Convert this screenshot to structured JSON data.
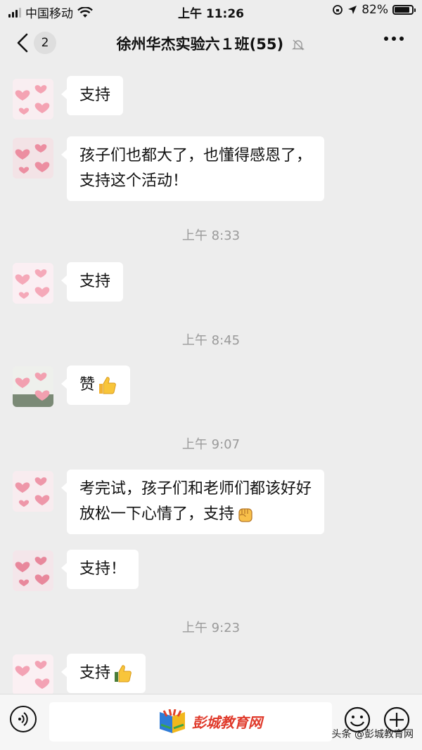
{
  "status_bar": {
    "carrier": "中国移动",
    "time": "上午 11:26",
    "battery": "82%"
  },
  "nav": {
    "back_count": "2",
    "title": "徐州华杰实验六１班(55)"
  },
  "messages": [
    {
      "lines": [
        "支持"
      ]
    },
    {
      "lines": [
        "孩子们也都大了，也懂得感恩了，",
        "支持这个活动！"
      ]
    },
    {
      "lines": [
        "支持"
      ]
    },
    {
      "lines": [
        "赞"
      ],
      "emoji": "thumbs-up-icon"
    },
    {
      "lines": [
        "考完试，孩子们和老师们都该好好",
        "放松一下心情了，支持"
      ],
      "emoji": "fist-icon"
    },
    {
      "lines": [
        "支持！"
      ]
    },
    {
      "lines": [
        "支持"
      ],
      "emoji": "thumbs-up-icon"
    }
  ],
  "timestamps": [
    "上午 8:33",
    "上午 8:45",
    "上午 9:07",
    "上午 9:23"
  ],
  "input_bar": {
    "logo_text": "彭城教育网"
  },
  "watermark": "头条 @彭城教育网",
  "colors": {
    "background": "#ededed",
    "bubble": "#ffffff",
    "timestamp": "#9a9a9a",
    "logo_red": "#e03a2b"
  }
}
